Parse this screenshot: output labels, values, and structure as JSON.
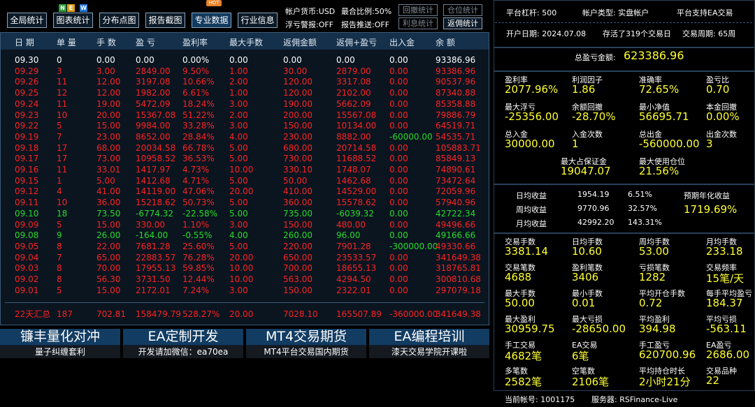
{
  "toolbar": {
    "btn_global": "全局统计",
    "btn_chart": "图表统计",
    "btn_scatter": "分布点图",
    "btn_report": "报告截图",
    "btn_pro": "专业数据",
    "btn_industry": "行业信息",
    "new_badge": [
      "N",
      "E",
      "W"
    ],
    "hot_badge": "HOT",
    "currency_label": "帐户货币:USD",
    "max_ratio_label": "最合比例:50%",
    "float_alert_label": "浮亏警报:OFF",
    "report_push_label": "报告推送:OFF",
    "btn_drawdown": "回撤统计",
    "btn_position": "仓位统计",
    "btn_interest": "利息统计",
    "btn_rebate": "返佣统计"
  },
  "table": {
    "headers": [
      "日 期",
      "单 量",
      "手 数",
      "盈 亏",
      "盈利率",
      "最大手数",
      "返佣金额",
      "返佣+盈亏",
      "出入金",
      "余 额"
    ],
    "rows": [
      {
        "c": "white",
        "v": [
          "09.30",
          "0",
          "0.00",
          "0.00",
          "0.00%",
          "0.00",
          "0.00",
          "0.00",
          "0.00",
          "93386.96"
        ]
      },
      {
        "c": "red",
        "v": [
          "09.29",
          "3",
          "3.00",
          "2849.00",
          "9.50%",
          "1.00",
          "30.00",
          "2879.00",
          "0.00",
          "93386.96"
        ]
      },
      {
        "c": "red",
        "v": [
          "09.26",
          "11",
          "12.00",
          "3197.08",
          "10.66%",
          "2.00",
          "120.00",
          "3317.08",
          "0.00",
          "90537.96"
        ]
      },
      {
        "c": "red",
        "v": [
          "09.25",
          "12",
          "12.00",
          "1982.00",
          "6.61%",
          "1.00",
          "120.00",
          "2102.00",
          "0.00",
          "87340.88"
        ]
      },
      {
        "c": "red",
        "v": [
          "09.24",
          "11",
          "19.00",
          "5472.09",
          "18.24%",
          "3.00",
          "190.00",
          "5662.09",
          "0.00",
          "85358.88"
        ]
      },
      {
        "c": "red",
        "v": [
          "09.23",
          "10",
          "20.00",
          "15367.08",
          "51.22%",
          "2.00",
          "200.00",
          "15567.08",
          "0.00",
          "79886.79"
        ]
      },
      {
        "c": "red",
        "v": [
          "09.22",
          "5",
          "15.00",
          "9984.00",
          "33.28%",
          "3.00",
          "150.00",
          "10134.00",
          "0.00",
          "64519.71"
        ]
      },
      {
        "c": "red",
        "v": [
          "09.19",
          "7",
          "23.00",
          "8652.00",
          "28.84%",
          "4.00",
          "230.00",
          "8882.00",
          "-60000.00",
          "54535.71"
        ],
        "fund": "green"
      },
      {
        "c": "red",
        "v": [
          "09.18",
          "17",
          "68.00",
          "20034.58",
          "66.78%",
          "5.00",
          "680.00",
          "20714.58",
          "0.00",
          "105883.71"
        ]
      },
      {
        "c": "red",
        "v": [
          "09.17",
          "17",
          "73.00",
          "10958.52",
          "36.53%",
          "5.00",
          "730.00",
          "11688.52",
          "0.00",
          "85849.13"
        ]
      },
      {
        "c": "red",
        "v": [
          "09.16",
          "11",
          "33.01",
          "1417.97",
          "4.73%",
          "10.00",
          "330.10",
          "1748.07",
          "0.00",
          "74890.61"
        ]
      },
      {
        "c": "red",
        "v": [
          "09.15",
          "1",
          "5.00",
          "1412.68",
          "4.71%",
          "5.00",
          "50.00",
          "1462.68",
          "0.00",
          "73472.64"
        ]
      },
      {
        "c": "red",
        "v": [
          "09.12",
          "4",
          "41.00",
          "14119.00",
          "47.06%",
          "20.00",
          "410.00",
          "14529.00",
          "0.00",
          "72059.96"
        ]
      },
      {
        "c": "red",
        "v": [
          "09.11",
          "10",
          "36.00",
          "15218.62",
          "50.73%",
          "5.00",
          "360.00",
          "15578.62",
          "0.00",
          "57940.96"
        ]
      },
      {
        "c": "green",
        "v": [
          "09.10",
          "18",
          "73.50",
          "-6774.32",
          "-22.58%",
          "5.00",
          "735.00",
          "-6039.32",
          "0.00",
          "42722.34"
        ]
      },
      {
        "c": "red",
        "v": [
          "09.09",
          "5",
          "15.00",
          "330.00",
          "1.10%",
          "3.00",
          "150.00",
          "480.00",
          "0.00",
          "49496.66"
        ]
      },
      {
        "c": "green",
        "v": [
          "09.08",
          "9",
          "26.00",
          "-164.00",
          "-0.55%",
          "4.00",
          "260.00",
          "96.00",
          "0.00",
          "49166.66"
        ]
      },
      {
        "c": "red",
        "v": [
          "09.05",
          "8",
          "22.00",
          "7681.28",
          "25.60%",
          "5.00",
          "220.00",
          "7901.28",
          "-300000.00",
          "49330.66"
        ],
        "fund": "green"
      },
      {
        "c": "red",
        "v": [
          "09.04",
          "7",
          "65.00",
          "22883.57",
          "76.28%",
          "20.00",
          "650.00",
          "23533.57",
          "0.00",
          "341649.38"
        ]
      },
      {
        "c": "red",
        "v": [
          "09.03",
          "8",
          "70.00",
          "17955.13",
          "59.85%",
          "10.00",
          "700.00",
          "18655.13",
          "0.00",
          "318765.81"
        ]
      },
      {
        "c": "red",
        "v": [
          "09.02",
          "8",
          "56.30",
          "3731.50",
          "12.44%",
          "10.00",
          "563.00",
          "4294.50",
          "0.00",
          "300810.68"
        ]
      },
      {
        "c": "red",
        "v": [
          "09.01",
          "5",
          "15.00",
          "2172.01",
          "7.24%",
          "3.00",
          "150.00",
          "2322.01",
          "0.00",
          "297079.18"
        ]
      }
    ],
    "summary": [
      "22天汇总",
      "187",
      "702.81",
      "158479.79",
      "528.27%",
      "20.00",
      "7028.10",
      "165507.89",
      "-360000.00",
      "341649.38"
    ]
  },
  "banners": [
    {
      "title": "镰丰量化对冲",
      "sub": "量子纠缠套利"
    },
    {
      "title": "EA定制开发",
      "sub": "开发请加微信：ea70ea"
    },
    {
      "title": "MT4交易期货",
      "sub": "MT4平台交易国内期货"
    },
    {
      "title": "EA编程培训",
      "sub": "漆天交易学院开课啦"
    }
  ],
  "panel": {
    "leverage": "平台杠杆:    500",
    "account_type": "帐户类型:    实盘帐户",
    "ea_support": "平台支持EA交易",
    "open_date": "开户日期:    2024.07.08",
    "survived": "存活了319个交易日",
    "cycle": "交易周期:    65周",
    "total_pl_label": "总盈亏金额:",
    "total_pl_value": "623386.96",
    "g1": [
      {
        "label": "盈利率",
        "value": "2077.96%"
      },
      {
        "label": "利润因子",
        "value": "1.86"
      },
      {
        "label": "准确率",
        "value": "72.65%"
      },
      {
        "label": "盈亏比",
        "value": "0.70"
      },
      {
        "label": "最大浮亏",
        "value": "-25356.00"
      },
      {
        "label": "余额回撤",
        "value": "-28.70%"
      },
      {
        "label": "最小净值",
        "value": "56695.71"
      },
      {
        "label": "本金回撤",
        "value": "0.00%"
      },
      {
        "label": "总入金",
        "value": "30000.00"
      },
      {
        "label": "入金次数",
        "value": "1"
      },
      {
        "label": "总出金",
        "value": "-560000.00"
      },
      {
        "label": "出金次数",
        "value": "3"
      },
      {
        "label": "最大占保证金",
        "value": "19047.07"
      },
      {
        "label": "最大使用仓位",
        "value": "21.56%"
      }
    ],
    "yield": {
      "daily_label": "日均收益",
      "daily_val": "1954.19",
      "daily_pct": "6.51%",
      "weekly_label": "周均收益",
      "weekly_val": "9770.96",
      "weekly_pct": "32.57%",
      "monthly_label": "月均收益",
      "monthly_val": "42992.20",
      "monthly_pct": "143.31%",
      "annual_label": "预期年化收益",
      "annual_val": "1719.69%"
    },
    "g2": [
      {
        "label": "交易手数",
        "value": "3381.14"
      },
      {
        "label": "日均手数",
        "value": "10.60"
      },
      {
        "label": "周均手数",
        "value": "53.00"
      },
      {
        "label": "月均手数",
        "value": "233.18"
      },
      {
        "label": "交易笔数",
        "value": "4688"
      },
      {
        "label": "盈利笔数",
        "value": "3406"
      },
      {
        "label": "亏损笔数",
        "value": "1282"
      },
      {
        "label": "交易频率",
        "value": "15笔/天"
      },
      {
        "label": "最大手数",
        "value": "50.00"
      },
      {
        "label": "最小手数",
        "value": "0.01"
      },
      {
        "label": "平均开仓手数",
        "value": "0.72"
      },
      {
        "label": "每手平均盈亏",
        "value": "184.37"
      },
      {
        "label": "最大盈利",
        "value": "30959.75"
      },
      {
        "label": "最大亏损",
        "value": "-28650.00"
      },
      {
        "label": "平均盈利",
        "value": "394.98"
      },
      {
        "label": "平均亏损",
        "value": "-563.11"
      },
      {
        "label": "手工交易",
        "value": "4682笔"
      },
      {
        "label": "EA交易",
        "value": "6笔"
      },
      {
        "label": "手工盈亏",
        "value": "620700.96"
      },
      {
        "label": "EA盈亏",
        "value": "2686.00"
      },
      {
        "label": "多笔数",
        "value": "2582笔"
      },
      {
        "label": "空笔数",
        "value": "2106笔"
      },
      {
        "label": "平均持仓时长",
        "value": "2小时21分"
      },
      {
        "label": "交易品种",
        "value": "22"
      }
    ],
    "account_no": "当前帐号:    1001175",
    "server": "服务器:    RSFinance-Live"
  },
  "colors": {
    "accent_yellow": "#ffff33",
    "profit_red": "#ff2222",
    "loss_green": "#2bd92b",
    "header_blue": "#15304a"
  }
}
